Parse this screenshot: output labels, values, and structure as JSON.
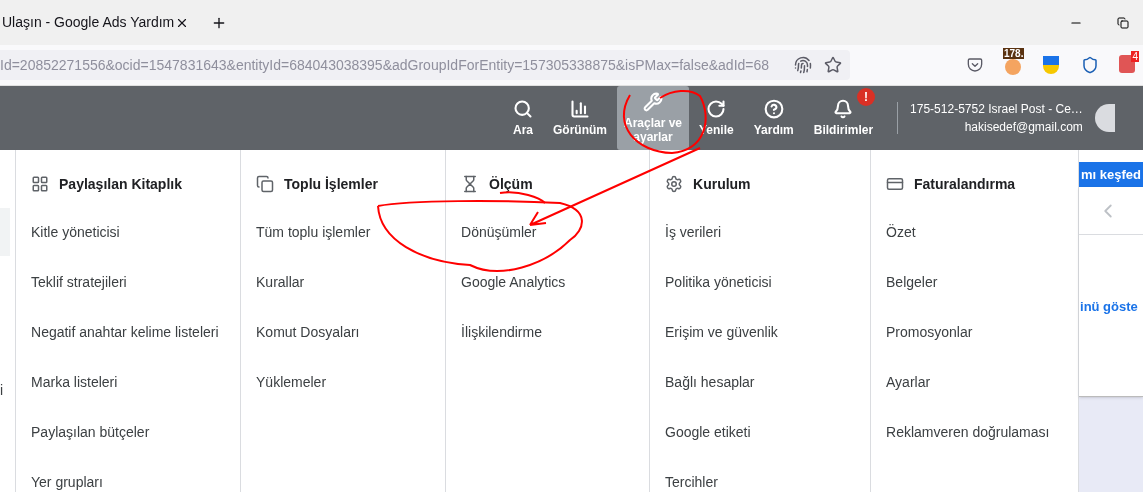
{
  "browser": {
    "tab_title": "Ulaşın - Google Ads Yardım",
    "url": "Id=20852271556&ocid=1547831643&entityId=684043038395&adGroupIdForEntity=157305338875&isPMax=false&adId=68",
    "extension_badges": [
      {
        "kind": "counter",
        "text": "178."
      },
      {
        "kind": "count",
        "text": "4"
      }
    ]
  },
  "header": {
    "actions": [
      {
        "kind": "search",
        "label": "Ara",
        "selected": false
      },
      {
        "kind": "view",
        "label": "Görünüm",
        "selected": false
      },
      {
        "kind": "tools",
        "label": "Araçlar ve ayarlar",
        "selected": true
      },
      {
        "kind": "refresh",
        "label": "Yenile",
        "selected": false
      },
      {
        "kind": "help",
        "label": "Yardım",
        "selected": false
      },
      {
        "kind": "notifications",
        "label": "Bildirimler",
        "selected": false,
        "alert": "!"
      }
    ],
    "account": {
      "name": "175-512-5752 Israel Post - Ce…",
      "email": "hakisedef@gmail.com"
    }
  },
  "left_sliver": "i",
  "menu": [
    {
      "kind": "library",
      "title": "Paylaşılan Kitaplık",
      "items": [
        "Kitle yöneticisi",
        "Teklif stratejileri",
        "Negatif anahtar kelime listeleri",
        "Marka listeleri",
        "Paylaşılan bütçeler",
        "Yer grupları"
      ]
    },
    {
      "kind": "bulk",
      "title": "Toplu İşlemler",
      "items": [
        "Tüm toplu işlemler",
        "Kurallar",
        "Komut Dosyaları",
        "Yüklemeler"
      ]
    },
    {
      "kind": "measure",
      "title": "Ölçüm",
      "items": [
        "Dönüşümler",
        "Google Analytics",
        "İlişkilendirme"
      ]
    },
    {
      "kind": "setup",
      "title": "Kurulum",
      "items": [
        "İş verileri",
        "Politika yöneticisi",
        "Erişim ve güvenlik",
        "Bağlı hesaplar",
        "Google etiketi",
        "Tercihler"
      ]
    },
    {
      "kind": "billing",
      "title": "Faturalandırma",
      "items": [
        "Özet",
        "Belgeler",
        "Promosyonlar",
        "Ayarlar",
        "Reklamveren doğrulaması"
      ]
    }
  ],
  "background": {
    "button": "mı keşfed",
    "link": "inü göste"
  }
}
